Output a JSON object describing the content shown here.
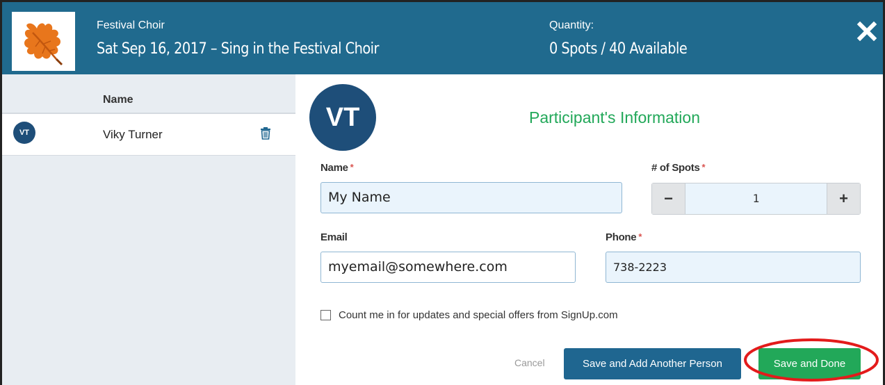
{
  "header": {
    "event_name": "Festival Choir",
    "event_title": "Sat Sep 16, 2017 – Sing in the Festival Choir",
    "quantity_label": "Quantity:",
    "quantity_value": "0 Spots / 40 Available",
    "logo_icon": "oak-leaf-icon",
    "close_icon": "close-icon",
    "bg_color": "#206a8e"
  },
  "sidebar": {
    "column_header": "Name",
    "participants": [
      {
        "initials": "VT",
        "name": "Viky Turner",
        "delete_icon": "trash-icon"
      }
    ]
  },
  "form": {
    "avatar_initials": "VT",
    "title": "Participant's Information",
    "name_label": "Name",
    "name_value": "My Name",
    "spots_label": "# of Spots",
    "spots_value": "1",
    "decrement": "−",
    "increment": "+",
    "email_label": "Email",
    "email_value": "myemail@somewhere.com",
    "phone_label": "Phone",
    "phone_value": "738-2223",
    "required_mark": "*",
    "optin_label": "Count me in for updates and special offers from SignUp.com",
    "optin_checked": false
  },
  "actions": {
    "cancel": "Cancel",
    "save_add": "Save and Add Another Person",
    "save_done": "Save and Done"
  },
  "colors": {
    "accent_green": "#22a859",
    "primary_blue": "#1f6690",
    "avatar_navy": "#1e4e79",
    "required_red": "#d9534f",
    "highlight_red": "#e31b1b"
  }
}
